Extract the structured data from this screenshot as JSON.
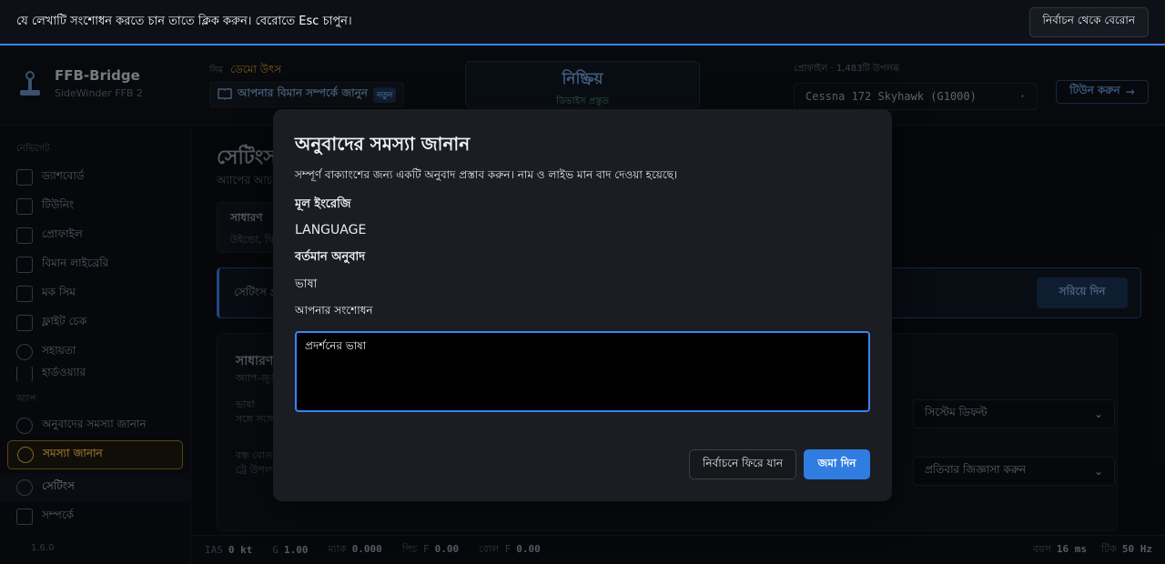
{
  "pick_bar": {
    "message": "যে লেখাটি সংশোধন করতে চান তাতে ক্লিক করুন। বেরোতে Esc চাপুন।",
    "exit_label": "নির্বাচন থেকে বেরোন"
  },
  "brand": {
    "title": "FFB-Bridge",
    "subtitle": "SideWinder FFB 2"
  },
  "sim_source": {
    "label": "সিম",
    "value": "ডেমো উৎস"
  },
  "learn": {
    "label": "আপনার বিমান সম্পর্কে জানুন",
    "badge": "নতুন"
  },
  "status": {
    "title": "নিষ্ক্রিয়",
    "subtitle": "ডিভাইস প্রস্তুত"
  },
  "profile": {
    "label": "প্রোফাইল · 1,483টি উপলব্ধ",
    "selected": "Cessna 172 Skyhawk (G1000)",
    "tune_label": "টিউন করুন"
  },
  "sidebar": {
    "nav_section": "নেভিগেট",
    "items": [
      {
        "label": "ড্যাশবোর্ড",
        "icon": "dashboard-icon"
      },
      {
        "label": "টিউনিং",
        "icon": "sliders-icon"
      },
      {
        "label": "প্রোফাইল",
        "icon": "list-icon"
      },
      {
        "label": "বিমান লাইব্রেরি",
        "icon": "book-icon"
      },
      {
        "label": "মক সিম",
        "icon": "gamepad-icon"
      },
      {
        "label": "ফ্লাইট চেক",
        "icon": "clipboard-icon"
      },
      {
        "label": "সহায়তা",
        "icon": "lifebuoy-icon"
      },
      {
        "label": "হার্ডওয়্যার",
        "icon": "hardware-icon"
      }
    ],
    "app_section": "অ্যাপ",
    "app_items": [
      {
        "label": "অনুবাদের সমস্যা জানান",
        "icon": "lifebuoy-icon"
      },
      {
        "label": "সমস্যা জানান",
        "icon": "lifebuoy-icon"
      },
      {
        "label": "সেটিংস",
        "icon": "gear-icon"
      },
      {
        "label": "সম্পর্কে",
        "icon": "window-icon"
      }
    ],
    "version": "1.6.0"
  },
  "main": {
    "title": "সেটিংস",
    "subtitle": "অ্যাপের আচ",
    "tab_card": {
      "title": "সাধারণ",
      "subtitle": "উইন্ডো, থি"
    },
    "notice": {
      "text": "সেটিংস প্র",
      "button": "সরিয়ে দিন"
    },
    "general": {
      "heading": "সাধারণ",
      "subheading": "অ্যাপ-জুড়",
      "row1": {
        "label": "ভাষা",
        "desc": "সঙ্গে সঙ্গে",
        "value": "সিস্টেম ডিফল্ট"
      },
      "row2": {
        "label": "বন্ধ বোতা",
        "desc": "ট্রে উপলব",
        "value": "প্রতিবার জিজ্ঞাসা করুন"
      }
    }
  },
  "statusbar": {
    "ias_label": "IAS",
    "ias": "0 kt",
    "g_label": "G",
    "g": "1.00",
    "mach_label": "ম্যাক",
    "mach": "0.000",
    "pitch_label": "পিচ F",
    "pitch": "0.00",
    "roll_label": "রোল F",
    "roll": "0.00",
    "latency_label": "বয়স",
    "latency": "16 ms",
    "tick_label": "টিক",
    "tick": "50 Hz"
  },
  "dialog": {
    "title": "অনুবাদের সমস্যা জানান",
    "description": "সম্পূর্ণ বাক্যাংশের জন্য একটি অনুবাদ প্রস্তাব করুন। নাম ও লাইভ মান বাদ দেওয়া হয়েছে।",
    "original_label": "মূল ইংরেজি",
    "original_value": "LANGUAGE",
    "current_label": "বর্তমান অনুবাদ",
    "current_value": "ভাষা",
    "fix_label": "আপনার সংশোধন",
    "fix_value": "প্রদর্শনের ভাষা",
    "back_label": "নির্বাচনে ফিরে যান",
    "submit_label": "জমা দিন"
  },
  "colors": {
    "accent": "#3b82f6",
    "highlight": "#e7b94a",
    "submit": "#2f7de1"
  }
}
